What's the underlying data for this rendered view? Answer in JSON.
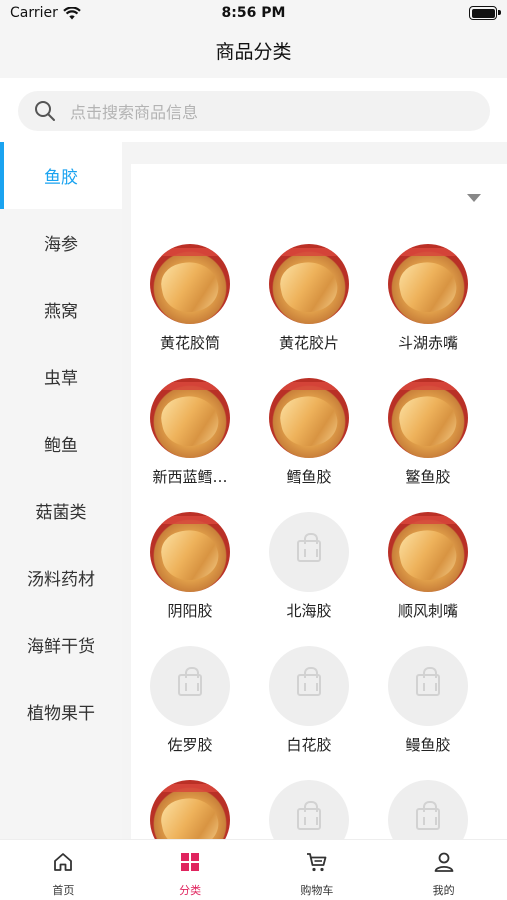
{
  "status_bar": {
    "carrier": "Carrier",
    "time": "8:56 PM"
  },
  "header": {
    "title": "商品分类"
  },
  "search": {
    "placeholder": "点击搜索商品信息"
  },
  "sidebar": {
    "active_color": "#1aa3f0",
    "items": [
      {
        "label": "鱼胶",
        "active": true
      },
      {
        "label": "海参",
        "active": false
      },
      {
        "label": "燕窝",
        "active": false
      },
      {
        "label": "虫草",
        "active": false
      },
      {
        "label": "鲍鱼",
        "active": false
      },
      {
        "label": "菇菌类",
        "active": false
      },
      {
        "label": "汤料药材",
        "active": false
      },
      {
        "label": "海鲜干货",
        "active": false
      },
      {
        "label": "植物果干",
        "active": false
      }
    ]
  },
  "products": [
    {
      "label": "黄花胶筒",
      "image": "photo"
    },
    {
      "label": "黄花胶片",
      "image": "photo"
    },
    {
      "label": "斗湖赤嘴",
      "image": "photo"
    },
    {
      "label": "新西蓝鳕…",
      "image": "photo"
    },
    {
      "label": "鳕鱼胶",
      "image": "photo"
    },
    {
      "label": "鳘鱼胶",
      "image": "photo"
    },
    {
      "label": "阴阳胶",
      "image": "photo"
    },
    {
      "label": "北海胶",
      "image": "placeholder"
    },
    {
      "label": "顺风刺嘴",
      "image": "photo"
    },
    {
      "label": "佐罗胶",
      "image": "placeholder"
    },
    {
      "label": "白花胶",
      "image": "placeholder"
    },
    {
      "label": "鳗鱼胶",
      "image": "placeholder"
    },
    {
      "label": "",
      "image": "photo"
    },
    {
      "label": "",
      "image": "placeholder"
    },
    {
      "label": "",
      "image": "placeholder"
    }
  ],
  "tabbar": {
    "active_color": "#e0245e",
    "tabs": [
      {
        "label": "首页",
        "icon": "home-icon",
        "active": false
      },
      {
        "label": "分类",
        "icon": "category-icon",
        "active": true
      },
      {
        "label": "购物车",
        "icon": "cart-icon",
        "active": false
      },
      {
        "label": "我的",
        "icon": "user-icon",
        "active": false
      }
    ]
  }
}
